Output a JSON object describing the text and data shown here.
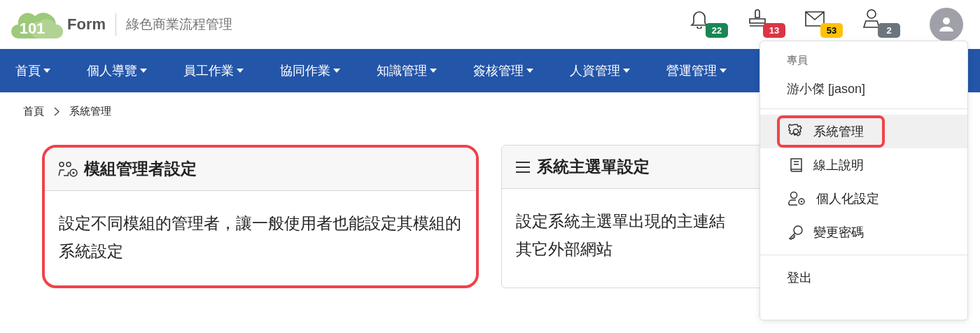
{
  "header": {
    "logo": {
      "number": "101",
      "name": "Form"
    },
    "subtitle": "綠色商業流程管理",
    "notifications": [
      {
        "kind": "bell",
        "count": "22",
        "color": "#198754"
      },
      {
        "kind": "stamp",
        "count": "13",
        "color": "#dc3545"
      },
      {
        "kind": "mail",
        "count": "53",
        "color": "#ffc107"
      },
      {
        "kind": "user",
        "count": "2",
        "color": "#6c757d"
      }
    ]
  },
  "nav": {
    "items": [
      "首頁",
      "個人導覽",
      "員工作業",
      "協同作業",
      "知識管理",
      "簽核管理",
      "人資管理",
      "營運管理"
    ]
  },
  "breadcrumb": [
    "首頁",
    "系統管理"
  ],
  "cards": [
    {
      "kind": "users-gear",
      "title": "模組管理者設定",
      "text": "設定不同模組的管理者，讓一般使用者也能設定其模組的系統設定",
      "highlighted": true
    },
    {
      "kind": "menu",
      "title": "系統主選單設定",
      "text": "設定系統主選單出現的主連結",
      "text_line_2": "其它外部網站",
      "highlighted": false
    }
  ],
  "user_menu": {
    "role": "專員",
    "user": "游小傑 [jason]",
    "items": [
      {
        "kind": "gear",
        "label": "系統管理",
        "selected": true,
        "highlighted": true
      },
      {
        "kind": "book",
        "label": "線上說明",
        "selected": false,
        "highlighted": false
      },
      {
        "kind": "user-gear",
        "label": "個人化設定",
        "selected": false,
        "highlighted": false
      },
      {
        "kind": "key",
        "label": "變更密碼",
        "selected": false,
        "highlighted": false
      }
    ],
    "logout": "登出"
  }
}
